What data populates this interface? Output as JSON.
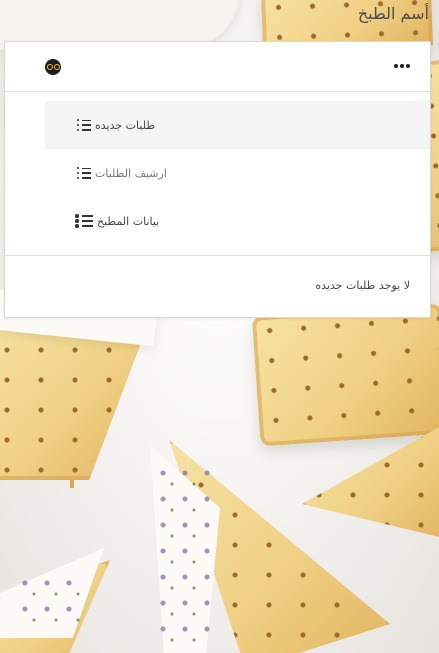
{
  "page": {
    "title": "أسم الطبخ"
  },
  "card": {
    "logo_icon": "glasses-logo-icon",
    "more_icon": "more-dots-icon",
    "menu": [
      {
        "label": "طلبات جديده",
        "icon": "list-icon",
        "active": true
      },
      {
        "label": "ارشيف الطلبات",
        "icon": "list-icon",
        "active": false
      },
      {
        "label": "بيانات المطبخ",
        "icon": "list-icon",
        "active": false
      }
    ],
    "empty_message": "لا يوجد طلبات جديده"
  },
  "colors": {
    "accent_logo": "#f2c230",
    "background_warm": "#f0d185",
    "active_item_bg": "#f4f4f4"
  }
}
